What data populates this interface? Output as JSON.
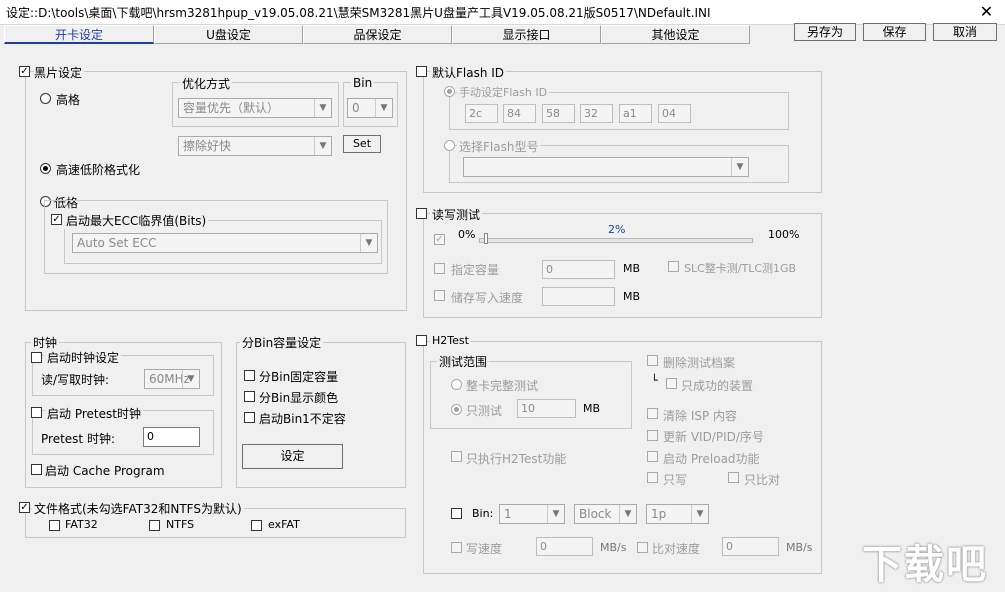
{
  "window": {
    "title": "设定::D:\\tools\\桌面\\下载吧\\hrsm3281hpup_v19.05.08.21\\慧荣SM3281黑片U盘量产工具V19.05.08.21版S0517\\NDefault.INI",
    "close": "✕"
  },
  "tabs": [
    "开卡设定",
    "U盘设定",
    "品保设定",
    "显示接口",
    "其他设定"
  ],
  "actions": {
    "save_as": "另存为",
    "save": "保存",
    "cancel": "取消"
  },
  "black_chip": {
    "label": "黑片设定",
    "mode_high": "高格",
    "mode_fast": "高速低阶格式化",
    "mode_low": "低格",
    "opt_label": "优化方式",
    "opt_value": "容量优先（默认）",
    "erase_value": "擦除好快",
    "bin_label": "Bin",
    "bin_value": "0",
    "set_button": "Set",
    "ecc_label": "启动最大ECC临界值(Bits)",
    "ecc_value": "Auto Set ECC"
  },
  "clock": {
    "label": "时钟",
    "enable_clock": "启动时钟设定",
    "rw_clock_label": "读/写取时钟:",
    "rw_clock_value": "60MHz",
    "enable_pretest": "启动 Pretest时钟",
    "pretest_label": "Pretest 时钟:",
    "pretest_value": "0",
    "cache_program": "启动 Cache Program"
  },
  "bin_capacity": {
    "label": "分Bin容量设定",
    "fixed": "分Bin固定容量",
    "color": "分Bin显示颜色",
    "bin1": "启动Bin1不定容",
    "set_button": "设定"
  },
  "file_format": {
    "label": "文件格式(未勾选FAT32和NTFS为默认)",
    "fat32": "FAT32",
    "ntfs": "NTFS",
    "exfat": "exFAT"
  },
  "flash_id": {
    "label": "默认Flash ID",
    "manual": "手动设定Flash ID",
    "ids": [
      "2c",
      "84",
      "58",
      "32",
      "a1",
      "04"
    ],
    "select_model": "选择Flash型号"
  },
  "rw_test": {
    "label": "读写测试",
    "min": "0%",
    "percent": "2%",
    "progress": 0.02,
    "max": "100%",
    "capacity_label": "指定容量",
    "capacity_value": "0",
    "capacity_unit": "MB",
    "slc": "SLC整卡测/TLC测1GB",
    "write_speed_label": "储存写入速度",
    "write_speed_unit": "MB"
  },
  "h2test": {
    "label": "H2Test",
    "range_label": "测试范围",
    "full": "整卡完整测试",
    "only": "只测试",
    "only_value": "10",
    "only_unit": "MB",
    "only_h2": "只执行H2Test功能",
    "delete_files": "删除测试档案",
    "only_success": "只成功的装置",
    "clear_isp": "清除 ISP 内容",
    "update_vid": "更新 VID/PID/序号",
    "preload": "启动 Preload功能",
    "write_only": "只写",
    "compare_only": "只比对",
    "bin_label": "Bin:",
    "bin_value": "1",
    "block_value": "Block",
    "page_value": "1p",
    "write_speed": "写速度",
    "write_speed_value": "0",
    "write_speed_unit": "MB/s",
    "compare_speed": "比对速度",
    "compare_speed_value": "0",
    "compare_speed_unit": "MB/s"
  },
  "watermark": "下载吧"
}
